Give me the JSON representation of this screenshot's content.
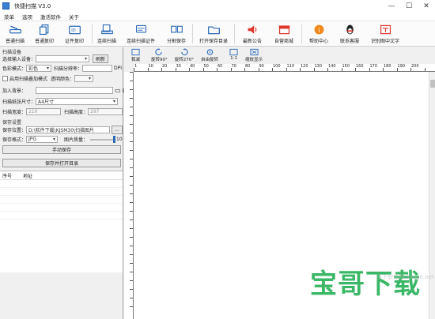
{
  "window": {
    "title": "快捷扫描 V3.0",
    "minimize": "—",
    "maximize": "☐",
    "close": "✕"
  },
  "menu": [
    "菜单",
    "选项",
    "激活软件",
    "关于"
  ],
  "toolbar": {
    "ordinary_scan": "普通扫描",
    "ordinary_copy": "普通复印",
    "id_copy": "证件复印",
    "continuous_scan": "连续扫描",
    "continuous_scan_id": "连续扫描证件",
    "split_save": "分割保存",
    "open_save_dir": "打开保存目录",
    "latest_notice": "最新公告",
    "self_mall": "自营商城",
    "help_center": "帮助中心",
    "contact_service": "联系客服",
    "recognize_text": "识别图中文字"
  },
  "image_tools": {
    "crop": "裁减",
    "rotate90": "旋转90°",
    "rotate270": "旋转270°",
    "auto_rotate": "自由旋转",
    "ratio": "1:1",
    "fit": "缩放显示",
    "crop_icon_text": "1:1"
  },
  "settings": {
    "section_title": "扫描设备",
    "input_device_label": "选择输入设备：",
    "input_device_value": "",
    "refresh": "刷新",
    "color_mode_label": "色彩模式：",
    "color_mode_value": "彩色",
    "resolution_label": "扫描分辨率：",
    "resolution_value": "",
    "resolution_unit": "DPI",
    "overlay_mode": "启用扫描叠加模式",
    "transparent_label": "透明颜色：",
    "background_label": "加入背景：",
    "paper_size_label": "扫描纸张尺寸：",
    "paper_size_value": "A4尺寸",
    "width_label": "扫描宽度：",
    "width_value": "210",
    "height_label": "扫描高度：",
    "height_value": "297",
    "save_section": "保存设置",
    "save_path_label": "保存位置：",
    "save_path_value": "D:\\软件下载\\KJSM30\\扫描图片",
    "browse": "...",
    "format_label": "保存格式：",
    "format_value": "JPG",
    "quality_label": "图片质量：",
    "quality_value": "10",
    "manual_save": "手动保存",
    "save_open": "保存并打开目录"
  },
  "table": {
    "col_index": "序号",
    "col_path": "地址"
  },
  "rulers": {
    "h": [
      "1",
      "10",
      "20",
      "30",
      "40",
      "50",
      "60",
      "70",
      "80",
      "90",
      "100",
      "110",
      "120",
      "130",
      "140",
      "150",
      "160",
      "170",
      "180",
      "190",
      "200"
    ],
    "v": [
      "10",
      "20",
      "30",
      "40",
      "50",
      "60",
      "70",
      "80",
      "90",
      "100",
      "110",
      "120",
      "130",
      "140",
      "150",
      "160",
      "170",
      "180",
      "190",
      "200",
      "210",
      "220",
      "230",
      "240",
      "250",
      "260",
      "270",
      "280"
    ]
  },
  "watermark": {
    "text": "宝哥下载",
    "sub": "当下软件园 baoge.net"
  },
  "colors": {
    "accent": "#2bb35b",
    "titlebar": "#ffffff",
    "panel": "#f0f0f0"
  }
}
